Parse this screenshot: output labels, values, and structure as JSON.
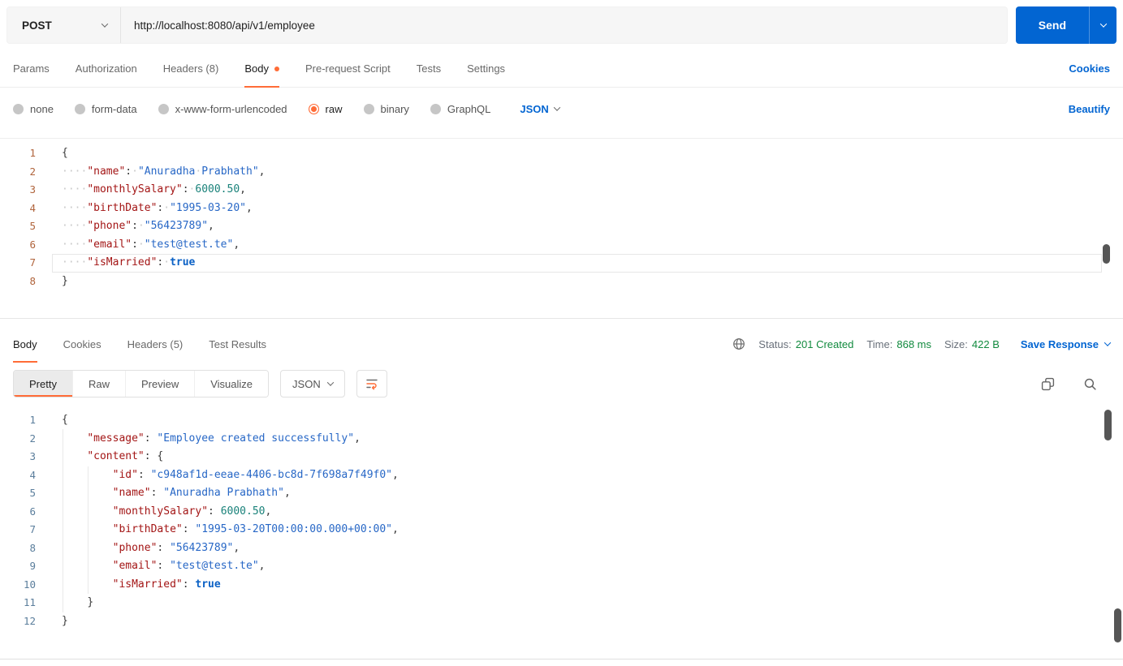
{
  "request": {
    "method": "POST",
    "url": "http://localhost:8080/api/v1/employee",
    "send": "Send",
    "tabs": [
      {
        "label": "Params",
        "active": false,
        "dot": false
      },
      {
        "label": "Authorization",
        "active": false,
        "dot": false
      },
      {
        "label": "Headers (8)",
        "active": false,
        "dot": false
      },
      {
        "label": "Body",
        "active": true,
        "dot": true
      },
      {
        "label": "Pre-request Script",
        "active": false,
        "dot": false
      },
      {
        "label": "Tests",
        "active": false,
        "dot": false
      },
      {
        "label": "Settings",
        "active": false,
        "dot": false
      }
    ],
    "cookies_link": "Cookies",
    "body_modes": [
      {
        "label": "none",
        "selected": false
      },
      {
        "label": "form-data",
        "selected": false
      },
      {
        "label": "x-www-form-urlencoded",
        "selected": false
      },
      {
        "label": "raw",
        "selected": true
      },
      {
        "label": "binary",
        "selected": false
      },
      {
        "label": "GraphQL",
        "selected": false
      }
    ],
    "language": "JSON",
    "beautify_link": "Beautify",
    "editor": {
      "active_line": 7,
      "lines": [
        [
          [
            "punc",
            "{"
          ]
        ],
        [
          [
            "ws",
            "····"
          ],
          [
            "key",
            "\"name\""
          ],
          [
            "punc",
            ":"
          ],
          [
            "ws",
            "·"
          ],
          [
            "str",
            "\"Anuradha"
          ],
          [
            "ws",
            "·"
          ],
          [
            "str",
            "Prabhath\""
          ],
          [
            "punc",
            ","
          ]
        ],
        [
          [
            "ws",
            "····"
          ],
          [
            "key",
            "\"monthlySalary\""
          ],
          [
            "punc",
            ":"
          ],
          [
            "ws",
            "·"
          ],
          [
            "num",
            "6000.50"
          ],
          [
            "punc",
            ","
          ]
        ],
        [
          [
            "ws",
            "····"
          ],
          [
            "key",
            "\"birthDate\""
          ],
          [
            "punc",
            ":"
          ],
          [
            "ws",
            "·"
          ],
          [
            "str",
            "\"1995-03-20\""
          ],
          [
            "punc",
            ","
          ]
        ],
        [
          [
            "ws",
            "····"
          ],
          [
            "key",
            "\"phone\""
          ],
          [
            "punc",
            ":"
          ],
          [
            "ws",
            "·"
          ],
          [
            "str",
            "\"56423789\""
          ],
          [
            "punc",
            ","
          ]
        ],
        [
          [
            "ws",
            "····"
          ],
          [
            "key",
            "\"email\""
          ],
          [
            "punc",
            ":"
          ],
          [
            "ws",
            "·"
          ],
          [
            "str",
            "\"test@test.te\""
          ],
          [
            "punc",
            ","
          ]
        ],
        [
          [
            "ws",
            "····"
          ],
          [
            "key",
            "\"isMarried\""
          ],
          [
            "punc",
            ":"
          ],
          [
            "ws",
            "·"
          ],
          [
            "bool",
            "true"
          ]
        ],
        [
          [
            "punc",
            "}"
          ]
        ]
      ]
    }
  },
  "response": {
    "tabs": [
      {
        "label": "Body",
        "active": true
      },
      {
        "label": "Cookies",
        "active": false
      },
      {
        "label": "Headers (5)",
        "active": false
      },
      {
        "label": "Test Results",
        "active": false
      }
    ],
    "meta": {
      "status_label": "Status:",
      "status_value": "201 Created",
      "time_label": "Time:",
      "time_value": "868 ms",
      "size_label": "Size:",
      "size_value": "422 B",
      "save_response": "Save Response"
    },
    "views": [
      {
        "label": "Pretty",
        "active": true
      },
      {
        "label": "Raw",
        "active": false
      },
      {
        "label": "Preview",
        "active": false
      },
      {
        "label": "Visualize",
        "active": false
      }
    ],
    "language": "JSON",
    "viewer": {
      "lines": [
        [
          [
            "punc",
            "{"
          ]
        ],
        [
          [
            "ws",
            "    "
          ],
          [
            "key",
            "\"message\""
          ],
          [
            "punc",
            ":"
          ],
          [
            "ws",
            " "
          ],
          [
            "str",
            "\"Employee created successfully\""
          ],
          [
            "punc",
            ","
          ]
        ],
        [
          [
            "ws",
            "    "
          ],
          [
            "key",
            "\"content\""
          ],
          [
            "punc",
            ":"
          ],
          [
            "ws",
            " "
          ],
          [
            "punc",
            "{"
          ]
        ],
        [
          [
            "ws",
            "        "
          ],
          [
            "key",
            "\"id\""
          ],
          [
            "punc",
            ":"
          ],
          [
            "ws",
            " "
          ],
          [
            "str",
            "\"c948af1d-eeae-4406-bc8d-7f698a7f49f0\""
          ],
          [
            "punc",
            ","
          ]
        ],
        [
          [
            "ws",
            "        "
          ],
          [
            "key",
            "\"name\""
          ],
          [
            "punc",
            ":"
          ],
          [
            "ws",
            " "
          ],
          [
            "str",
            "\"Anuradha Prabhath\""
          ],
          [
            "punc",
            ","
          ]
        ],
        [
          [
            "ws",
            "        "
          ],
          [
            "key",
            "\"monthlySalary\""
          ],
          [
            "punc",
            ":"
          ],
          [
            "ws",
            " "
          ],
          [
            "num",
            "6000.50"
          ],
          [
            "punc",
            ","
          ]
        ],
        [
          [
            "ws",
            "        "
          ],
          [
            "key",
            "\"birthDate\""
          ],
          [
            "punc",
            ":"
          ],
          [
            "ws",
            " "
          ],
          [
            "str",
            "\"1995-03-20T00:00:00.000+00:00\""
          ],
          [
            "punc",
            ","
          ]
        ],
        [
          [
            "ws",
            "        "
          ],
          [
            "key",
            "\"phone\""
          ],
          [
            "punc",
            ":"
          ],
          [
            "ws",
            " "
          ],
          [
            "str",
            "\"56423789\""
          ],
          [
            "punc",
            ","
          ]
        ],
        [
          [
            "ws",
            "        "
          ],
          [
            "key",
            "\"email\""
          ],
          [
            "punc",
            ":"
          ],
          [
            "ws",
            " "
          ],
          [
            "str",
            "\"test@test.te\""
          ],
          [
            "punc",
            ","
          ]
        ],
        [
          [
            "ws",
            "        "
          ],
          [
            "key",
            "\"isMarried\""
          ],
          [
            "punc",
            ":"
          ],
          [
            "ws",
            " "
          ],
          [
            "bool",
            "true"
          ]
        ],
        [
          [
            "ws",
            "    "
          ],
          [
            "punc",
            "}"
          ]
        ],
        [
          [
            "punc",
            "}"
          ]
        ]
      ]
    }
  },
  "colors": {
    "accent_orange": "#FF6C37",
    "primary_blue": "#0265D2",
    "success_green": "#118A3E",
    "json_key": "#A31515",
    "json_string": "#2767C6",
    "json_number": "#1A827A",
    "json_boolean": "#0B61C5"
  },
  "icons": {
    "method_chevron": "chevron-down",
    "send_chevron": "chevron-down",
    "language_chevron": "chevron-down",
    "save_response_chevron": "chevron-down",
    "network": "globe",
    "copy": "overlapping-squares",
    "search": "magnifier",
    "line_wrap": "wrap-lines"
  }
}
